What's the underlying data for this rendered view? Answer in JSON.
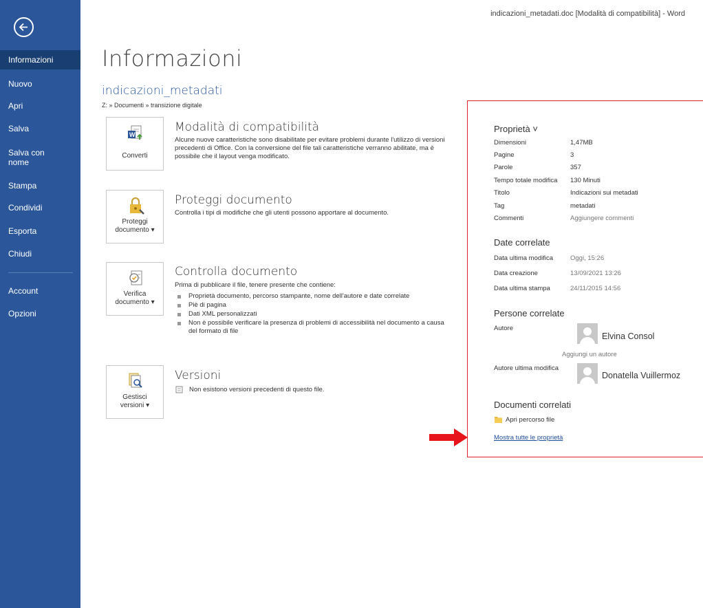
{
  "window_title": "indicazioni_metadati.doc [Modalità di compatibilità] - Word",
  "sidebar": {
    "items": [
      {
        "label": "Informazioni",
        "active": true
      },
      {
        "label": "Nuovo"
      },
      {
        "label": "Apri"
      },
      {
        "label": "Salva"
      },
      {
        "label": "Salva con nome"
      },
      {
        "label": "Stampa"
      },
      {
        "label": "Condividi"
      },
      {
        "label": "Esporta"
      },
      {
        "label": "Chiudi"
      },
      {
        "label": "Account"
      },
      {
        "label": "Opzioni"
      }
    ]
  },
  "main": {
    "title": "Informazioni",
    "doc_name": "indicazioni_metadati",
    "doc_path": "Z: » Documenti » transizione digitale",
    "sections": {
      "compat": {
        "button": "Converti",
        "title": "Modalità di compatibilità",
        "text": "Alcune nuove caratteristiche sono disabilitate per evitare problemi durante l'utilizzo di versioni precedenti di Office. Con la conversione del file tali caratteristiche verranno abilitate, ma è possibile che il layout venga modificato."
      },
      "protect": {
        "button_line1": "Proteggi",
        "button_line2": "documento ▾",
        "title": "Proteggi documento",
        "text": "Controlla i tipi di modifiche che gli utenti possono apportare al documento."
      },
      "inspect": {
        "button_line1": "Verifica",
        "button_line2": "documento ▾",
        "title": "Controlla documento",
        "text": "Prima di pubblicare il file, tenere presente che contiene:",
        "bullets": [
          "Proprietà documento, percorso stampante, nome dell'autore e date correlate",
          "Piè di pagina",
          "Dati XML personalizzati",
          "Non è possibile verificare la presenza di problemi di accessibilità nel documento a causa del formato di file"
        ]
      },
      "versions": {
        "button_line1": "Gestisci",
        "button_line2": "versioni ▾",
        "title": "Versioni",
        "text": "Non esistono versioni precedenti di questo file."
      }
    }
  },
  "properties": {
    "header": "Proprietà ˅",
    "rows": [
      {
        "label": "Dimensioni",
        "value": "1,47MB"
      },
      {
        "label": "Pagine",
        "value": "3"
      },
      {
        "label": "Parole",
        "value": "357"
      },
      {
        "label": "Tempo totale modifica",
        "value": "130 Minuti"
      },
      {
        "label": "Titolo",
        "value": "Indicazioni sui metadati"
      },
      {
        "label": "Tag",
        "value": "metadati"
      },
      {
        "label": "Commenti",
        "value": "Aggiungere commenti"
      }
    ],
    "dates_header": "Date correlate",
    "dates": [
      {
        "label": "Data ultima modifica",
        "value": "Oggi, 15:26"
      },
      {
        "label": "Data creazione",
        "value": "13/09/2021 13:26"
      },
      {
        "label": "Data ultima stampa",
        "value": "24/11/2015 14:56"
      }
    ],
    "people_header": "Persone correlate",
    "author_label": "Autore",
    "author_name": "Elvina Consol",
    "add_author": "Aggiungi un autore",
    "last_modified_label": "Autore ultima modifica",
    "last_modified_name": "Donatella Vuillermoz",
    "related_docs_header": "Documenti correlati",
    "open_location": "Apri percorso file",
    "show_all": "Mostra tutte le proprietà"
  },
  "colors": {
    "sidebar": "#2b579a",
    "sidebar_active": "#193e72",
    "highlight_border": "#e0202a",
    "arrow": "#e8141c"
  }
}
